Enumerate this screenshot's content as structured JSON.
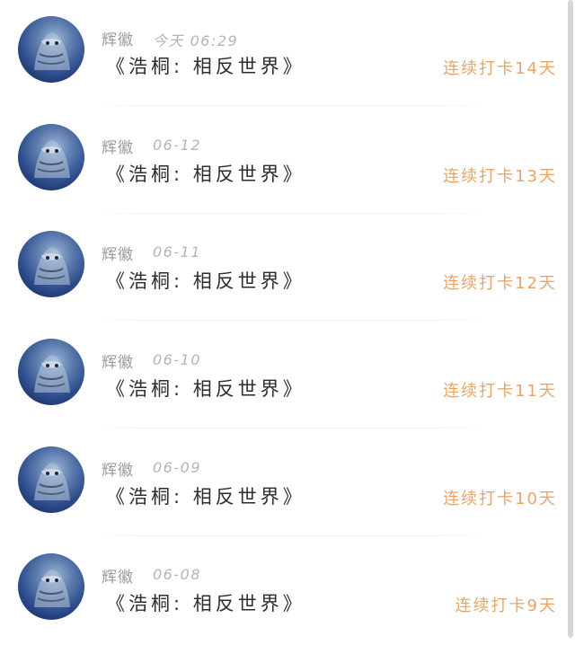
{
  "entries": [
    {
      "user": "辉徽",
      "time": "今天 06:29",
      "title": "《浩桐: 相反世界》",
      "streak": "连续打卡14天"
    },
    {
      "user": "辉徽",
      "time": "06-12",
      "title": "《浩桐: 相反世界》",
      "streak": "连续打卡13天"
    },
    {
      "user": "辉徽",
      "time": "06-11",
      "title": "《浩桐: 相反世界》",
      "streak": "连续打卡12天"
    },
    {
      "user": "辉徽",
      "time": "06-10",
      "title": "《浩桐: 相反世界》",
      "streak": "连续打卡11天"
    },
    {
      "user": "辉徽",
      "time": "06-09",
      "title": "《浩桐: 相反世界》",
      "streak": "连续打卡10天"
    },
    {
      "user": "辉徽",
      "time": "06-08",
      "title": "《浩桐: 相反世界》",
      "streak": "连续打卡9天"
    }
  ],
  "colors": {
    "streak": "#e8a56a",
    "title": "#2d2d2d",
    "meta": "#9a9a9a"
  }
}
